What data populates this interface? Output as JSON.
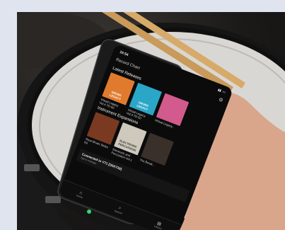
{
  "phone": {
    "time": "10:54",
    "app_title": "Record Chart",
    "settings_icon": "gear-icon",
    "latest_section": "Latest Releases",
    "latest_items": [
      {
        "cover_text": "DRUMS LEGACY",
        "label": "Virtual Legacy Vol.4 TD-50",
        "color": "#e07b2e"
      },
      {
        "cover_text": "DRUMS LEGACY",
        "label": "Virtual Legacy Vol.3 TD-50",
        "color": "#2aa6c7"
      },
      {
        "cover_text": "",
        "label": "Virtual Legacy...",
        "color": "#d25a8c"
      }
    ],
    "instrument_section": "Instrument Expansions",
    "instrument_items": [
      {
        "cover_text": "",
        "label": "Steel Brush Sticks Kit",
        "color": "#7a3a22"
      },
      {
        "cover_text": "ELECTRONIC PERCUSSION",
        "label": "Electronic and Percussion Vol.1",
        "color": "#cfc9bd"
      },
      {
        "cover_text": "",
        "label": "The Break...",
        "color": "#3a302a"
      }
    ],
    "banner_title": "Connected to V71 [D5K739]",
    "banner_sub": "Tap to manage",
    "tabs": [
      {
        "label": "Home",
        "icon": "home-icon",
        "glyph": "⌂"
      },
      {
        "label": "Search",
        "icon": "search-icon",
        "glyph": "⌕"
      },
      {
        "label": "Library",
        "icon": "library-icon",
        "glyph": "▤"
      }
    ]
  }
}
